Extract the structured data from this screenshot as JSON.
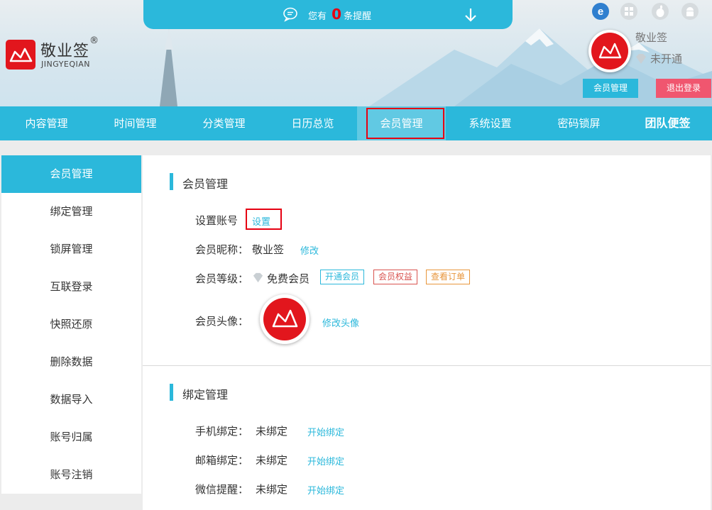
{
  "header": {
    "notice_prefix": "您有",
    "notice_count": "0",
    "notice_suffix": "条提醒",
    "logo_name": "敬业签",
    "logo_reg": "®",
    "logo_en": "JINGYEQIAN",
    "platforms": [
      "ie-icon",
      "windows-icon",
      "apple-icon",
      "android-icon"
    ],
    "user_name": "敬业签",
    "vip_status": "未开通",
    "member_button": "会员管理",
    "logout_button": "退出登录"
  },
  "nav": {
    "items": [
      "内容管理",
      "时间管理",
      "分类管理",
      "日历总览",
      "会员管理",
      "系统设置",
      "密码锁屏",
      "团队便签"
    ],
    "active_index": 4
  },
  "sidebar": {
    "items": [
      "会员管理",
      "绑定管理",
      "锁屏管理",
      "互联登录",
      "快照还原",
      "删除数据",
      "数据导入",
      "账号归属",
      "账号注销"
    ],
    "active_index": 0
  },
  "member_section": {
    "title": "会员管理",
    "account_label": "设置账号",
    "account_link": "设置",
    "nickname_label": "会员昵称：",
    "nickname_value": "敬业签",
    "nickname_link": "修改",
    "level_label": "会员等级：",
    "level_value": "免费会员",
    "tags": [
      "开通会员",
      "会员权益",
      "查看订单"
    ],
    "avatar_label": "会员头像：",
    "avatar_link": "修改头像"
  },
  "bind_section": {
    "title": "绑定管理",
    "rows": [
      {
        "label": "手机绑定：",
        "value": "未绑定",
        "link": "开始绑定"
      },
      {
        "label": "邮箱绑定：",
        "value": "未绑定",
        "link": "开始绑定"
      },
      {
        "label": "微信提醒：",
        "value": "未绑定",
        "link": "开始绑定"
      }
    ]
  },
  "colors": {
    "accent": "#2bb8db",
    "brand_red": "#e2161d",
    "logout": "#f0566f",
    "highlight": "#e60012"
  }
}
